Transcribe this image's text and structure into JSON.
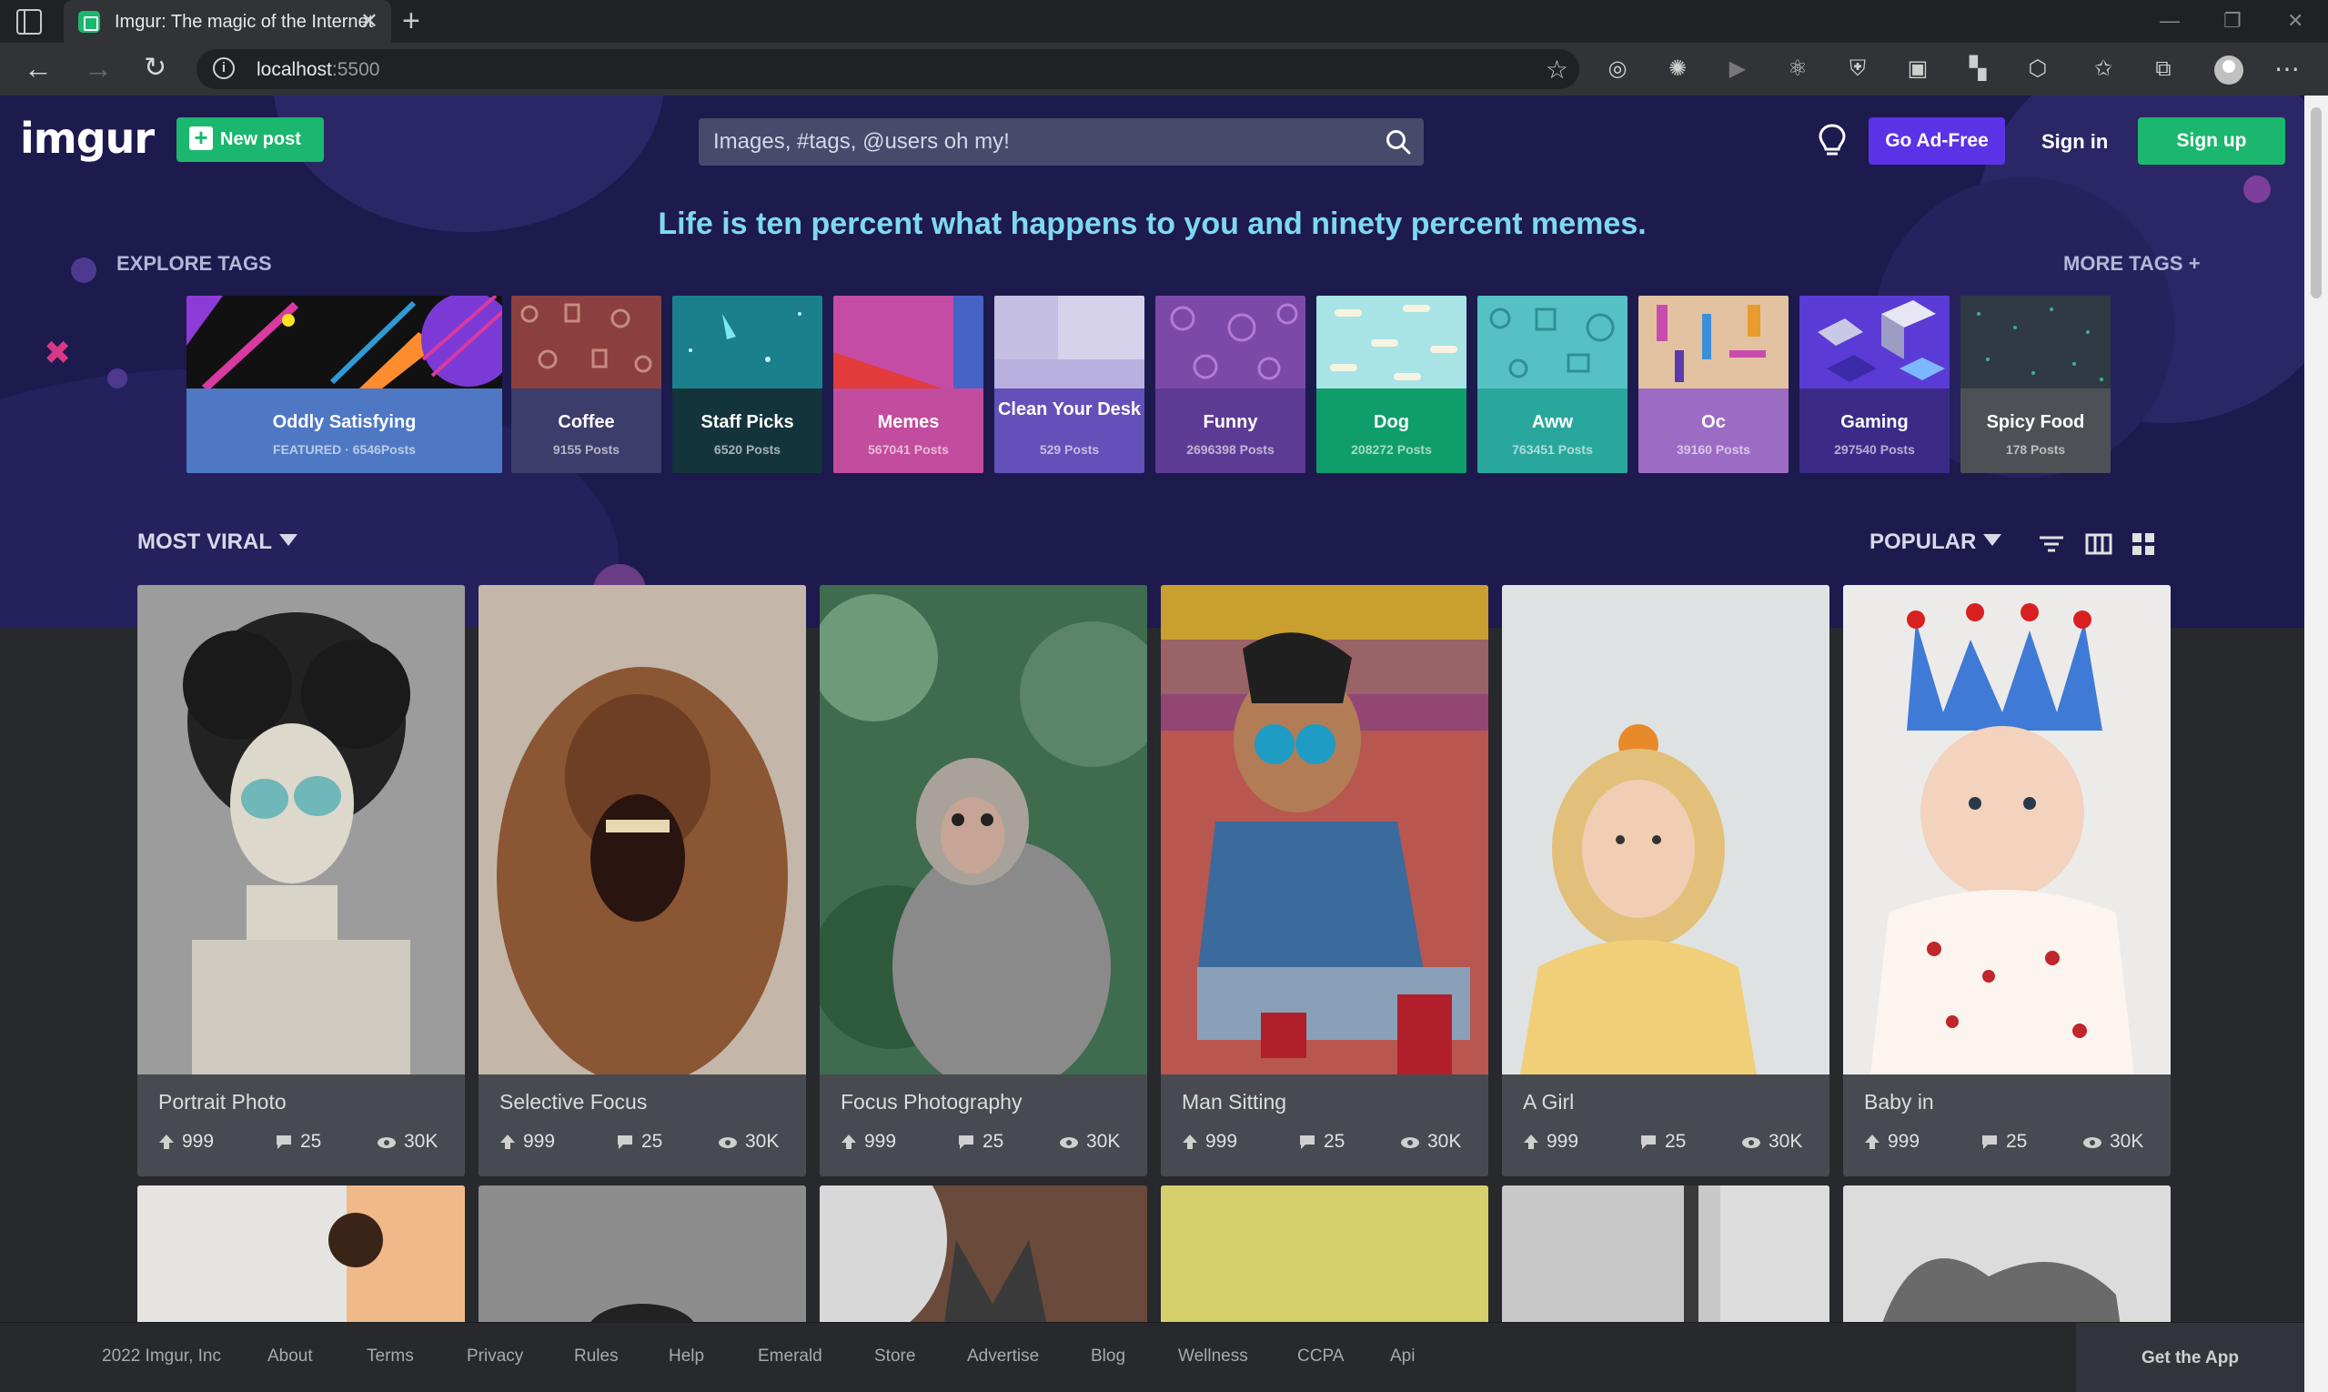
{
  "browser": {
    "tab_title": "Imgur: The magic of the Internet",
    "url_host": "localhost",
    "url_port": ":5500"
  },
  "header": {
    "logo": "imgur",
    "new_post": "New post",
    "search_placeholder": "Images, #tags, @users oh my!",
    "go_adfree": "Go Ad-Free",
    "sign_in": "Sign in",
    "sign_up": "Sign up"
  },
  "hero": {
    "quote": "Life is ten percent what happens to you and ninety percent memes.",
    "explore_tags": "EXPLORE TAGS",
    "more_tags": "MORE TAGS +"
  },
  "tags": [
    {
      "name": "Oddly Satisfying",
      "posts": "FEATURED · 6546Posts",
      "color": "#4e78c4"
    },
    {
      "name": "Coffee",
      "posts": "9155 Posts",
      "color": "#3d3d6b"
    },
    {
      "name": "Staff Picks",
      "posts": "6520 Posts",
      "color": "#14343c"
    },
    {
      "name": "Memes",
      "posts": "567041 Posts",
      "color": "#c24c9d"
    },
    {
      "name": "Clean Your Desk",
      "posts": "529 Posts",
      "color": "#6350b8"
    },
    {
      "name": "Funny",
      "posts": "2696398 Posts",
      "color": "#5d3b94"
    },
    {
      "name": "Dog",
      "posts": "208272 Posts",
      "color": "#0f9d6b"
    },
    {
      "name": "Aww",
      "posts": "763451 Posts",
      "color": "#29a79d"
    },
    {
      "name": "Oc",
      "posts": "39160 Posts",
      "color": "#9c6cc4"
    },
    {
      "name": "Gaming",
      "posts": "297540 Posts",
      "color": "#3b2b86"
    },
    {
      "name": "Spicy Food",
      "posts": "178 Posts",
      "color": "#4d5156"
    }
  ],
  "feed": {
    "section": "MOST VIRAL",
    "sort": "POPULAR",
    "posts": [
      {
        "title": "Portrait Photo",
        "upvotes": "999",
        "comments": "25",
        "views": "30K"
      },
      {
        "title": "Selective Focus",
        "upvotes": "999",
        "comments": "25",
        "views": "30K"
      },
      {
        "title": "Focus Photography",
        "upvotes": "999",
        "comments": "25",
        "views": "30K"
      },
      {
        "title": "Man Sitting",
        "upvotes": "999",
        "comments": "25",
        "views": "30K"
      },
      {
        "title": "A Girl",
        "upvotes": "999",
        "comments": "25",
        "views": "30K"
      },
      {
        "title": "Baby in",
        "upvotes": "999",
        "comments": "25",
        "views": "30K"
      }
    ]
  },
  "footer": {
    "links": [
      "2022 Imgur, Inc",
      "About",
      "Terms",
      "Privacy",
      "Rules",
      "Help",
      "Emerald",
      "Store",
      "Advertise",
      "Blog",
      "Wellness",
      "CCPA",
      "Api"
    ],
    "get_app": "Get the App"
  }
}
